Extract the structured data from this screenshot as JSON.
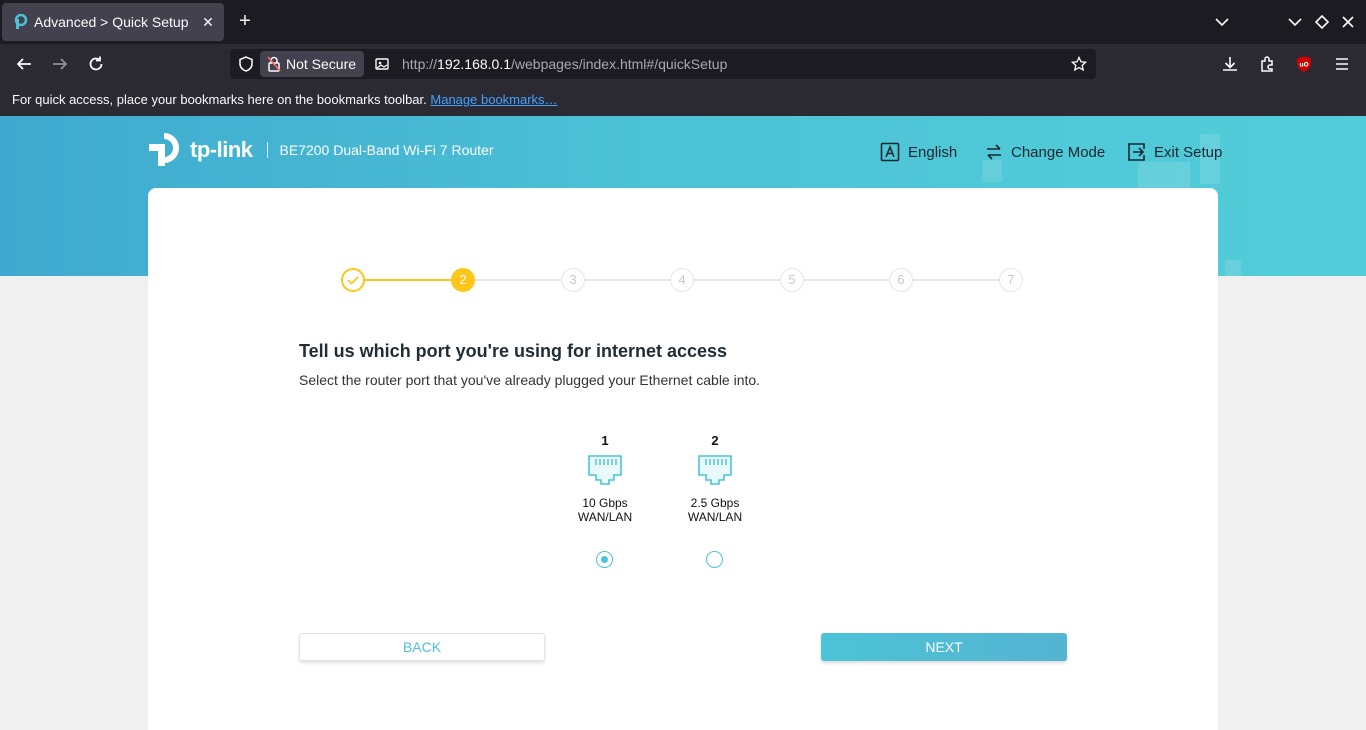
{
  "browser": {
    "tab_title": "Advanced > Quick Setup",
    "security_label": "Not Secure",
    "url_prefix": "http://",
    "url_host": "192.168.0.1",
    "url_path": "/webpages/index.html#/quickSetup",
    "bookmarks_text": "For quick access, place your bookmarks here on the bookmarks toolbar.",
    "bookmarks_link": "Manage bookmarks…"
  },
  "header": {
    "brand": "tp-link",
    "model": "BE7200 Dual-Band Wi-Fi 7 Router",
    "language": "English",
    "change_mode": "Change Mode",
    "exit_setup": "Exit Setup"
  },
  "stepper": {
    "current_step": 2,
    "steps": [
      "",
      "2",
      "3",
      "4",
      "5",
      "6",
      "7"
    ]
  },
  "content": {
    "title": "Tell us which port you're using for internet access",
    "subtitle": "Select the router port that you've already plugged your Ethernet cable into."
  },
  "ports": [
    {
      "number": "1",
      "speed": "10 Gbps",
      "type": "WAN/LAN",
      "selected": true
    },
    {
      "number": "2",
      "speed": "2.5 Gbps",
      "type": "WAN/LAN",
      "selected": false
    }
  ],
  "buttons": {
    "back": "BACK",
    "next": "NEXT"
  },
  "colors": {
    "accent": "#4cc3d6",
    "step_active": "#ffc61a",
    "browser_dark": "#1c1b22"
  }
}
